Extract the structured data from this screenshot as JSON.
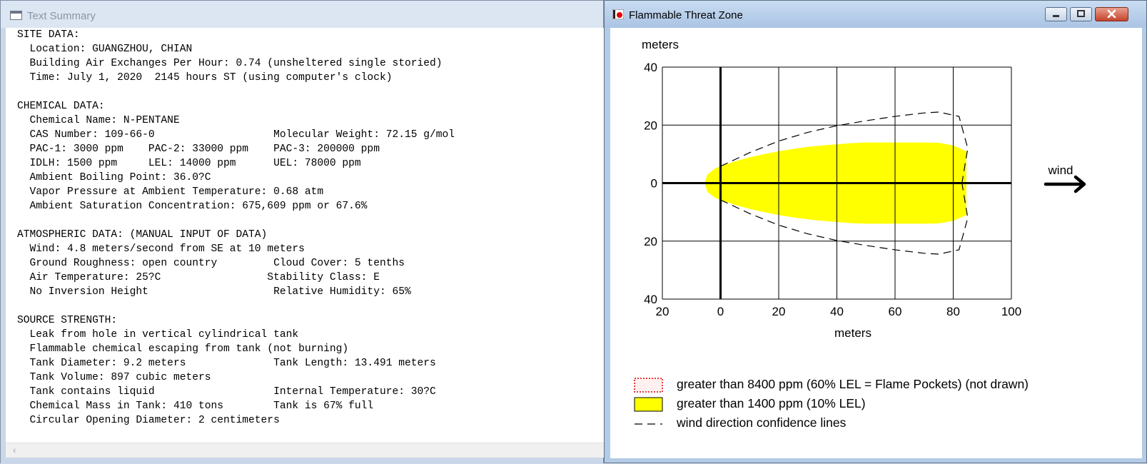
{
  "summary_window": {
    "title": "Text Summary",
    "lines": [
      "SITE DATA:",
      "  Location: GUANGZHOU, CHIAN",
      "  Building Air Exchanges Per Hour: 0.74 (unsheltered single storied)",
      "  Time: July 1, 2020  2145 hours ST (using computer's clock)",
      "",
      "CHEMICAL DATA:",
      "  Chemical Name: N-PENTANE",
      "  CAS Number: 109-66-0                   Molecular Weight: 72.15 g/mol",
      "  PAC-1: 3000 ppm    PAC-2: 33000 ppm    PAC-3: 200000 ppm",
      "  IDLH: 1500 ppm     LEL: 14000 ppm      UEL: 78000 ppm",
      "  Ambient Boiling Point: 36.0?C",
      "  Vapor Pressure at Ambient Temperature: 0.68 atm",
      "  Ambient Saturation Concentration: 675,609 ppm or 67.6%",
      "",
      "ATMOSPHERIC DATA: (MANUAL INPUT OF DATA)",
      "  Wind: 4.8 meters/second from SE at 10 meters",
      "  Ground Roughness: open country         Cloud Cover: 5 tenths",
      "  Air Temperature: 25?C                 Stability Class: E",
      "  No Inversion Height                    Relative Humidity: 65%",
      "",
      "SOURCE STRENGTH:",
      "  Leak from hole in vertical cylindrical tank",
      "  Flammable chemical escaping from tank (not burning)",
      "  Tank Diameter: 9.2 meters              Tank Length: 13.491 meters",
      "  Tank Volume: 897 cubic meters",
      "  Tank contains liquid                   Internal Temperature: 30?C",
      "  Chemical Mass in Tank: 410 tons        Tank is 67% full",
      "  Circular Opening Diameter: 2 centimeters"
    ]
  },
  "zone_window": {
    "title": "Flammable Threat Zone",
    "wind_label": "wind",
    "legend": [
      {
        "label": "greater than 8400 ppm (60% LEL = Flame Pockets) (not drawn)",
        "swatch": "dotted-red"
      },
      {
        "label": "greater than 1400 ppm (10% LEL)",
        "swatch": "yellow"
      },
      {
        "label": "wind direction confidence lines",
        "swatch": "dashed-line"
      }
    ]
  },
  "colors": {
    "threat_zone_fill": "#ffff00",
    "flame_pocket_swatch": "#ff0000"
  },
  "chart_data": {
    "type": "area",
    "title": "",
    "xlabel": "meters",
    "ylabel": "meters",
    "xlim": [
      -20,
      100
    ],
    "ylim": [
      -40,
      40
    ],
    "x_ticks": [
      -20,
      0,
      20,
      40,
      60,
      80,
      100
    ],
    "x_tick_labels": [
      "20",
      "0",
      "20",
      "40",
      "60",
      "80",
      "100"
    ],
    "y_ticks": [
      40,
      20,
      0,
      -20,
      -40
    ],
    "y_tick_labels": [
      "40",
      "20",
      "0",
      "20",
      "40"
    ],
    "grid": true,
    "legend_position": "bottom",
    "threat_zone": {
      "name": "greater than 1400 ppm (10% LEL)",
      "x": [
        -5.5,
        -4.5,
        -2,
        0,
        5,
        10,
        15,
        20,
        25,
        30,
        35,
        40,
        45,
        50,
        55,
        60,
        65,
        70,
        75,
        80,
        84.5,
        84.5
      ],
      "half_width": [
        0,
        3,
        5,
        5.8,
        7.5,
        8.9,
        10,
        11,
        11.8,
        12.5,
        13,
        13.4,
        13.8,
        14,
        14,
        14,
        14,
        14,
        13.9,
        13,
        11,
        0
      ]
    },
    "confidence_lines": {
      "name": "wind direction confidence lines",
      "x": [
        0,
        10,
        20,
        30,
        40,
        50,
        60,
        70,
        75,
        82,
        85,
        83
      ],
      "half_width": [
        5.8,
        10.5,
        14.5,
        17.5,
        19.8,
        21.5,
        23,
        24.2,
        24.5,
        23,
        12,
        0
      ]
    }
  }
}
